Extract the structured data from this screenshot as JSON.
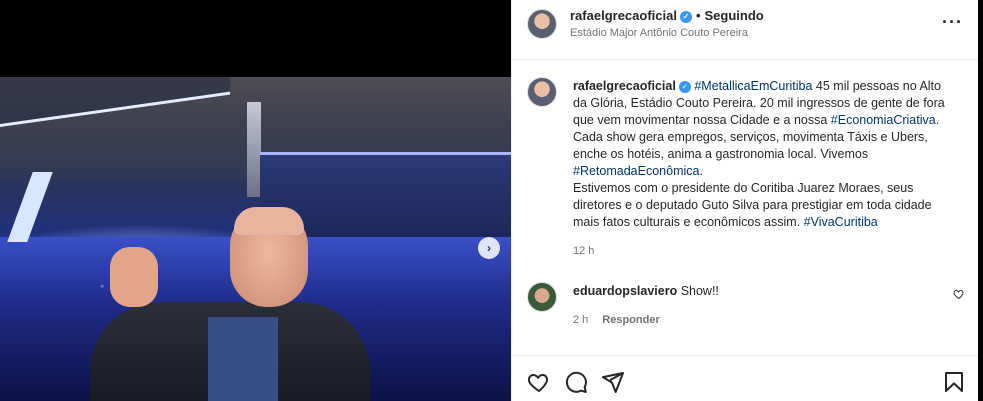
{
  "media": {
    "next_icon": "chevron-right-icon",
    "next_glyph": "›"
  },
  "header": {
    "username": "rafaelgrecaoficial",
    "verified_glyph": "✓",
    "separator": "•",
    "follow_label": "Seguindo",
    "location": "Estádio Major Antônio Couto Pereira",
    "more_label": "···"
  },
  "caption": {
    "username": "rafaelgrecaoficial",
    "verified_glyph": "✓",
    "segments": {
      "tag1": "#MetallicaEmCuritiba",
      "text1": " 45 mil pessoas no Alto da Glória, Estádio Couto Pereira. 20 mil ingressos de gente de fora que vem movimentar nossa Cidade e a nossa ",
      "tag2": "#EconomiaCriativa",
      "text2": ". Cada show gera empregos, serviços, movimenta Táxis e Ubers, enche os hotéis, anima a gastronomia local. Vivemos ",
      "tag3": "#RetomadaEconômica",
      "text3": ".",
      "text4": "Estivemos com o presidente do Coritiba Juarez Moraes, seus diretores e o deputado Guto Silva para prestigiar em toda cidade mais fatos culturais e econômicos assim. ",
      "tag4": "#VivaCuritiba"
    },
    "time": "12 h"
  },
  "comment": {
    "username": "eduardopslaviero",
    "text": "Show!!",
    "time": "2 h",
    "reply_label": "Responder"
  },
  "actions": {
    "like_icon": "heart-icon",
    "comment_icon": "comment-icon",
    "share_icon": "share-icon",
    "save_icon": "bookmark-icon"
  }
}
